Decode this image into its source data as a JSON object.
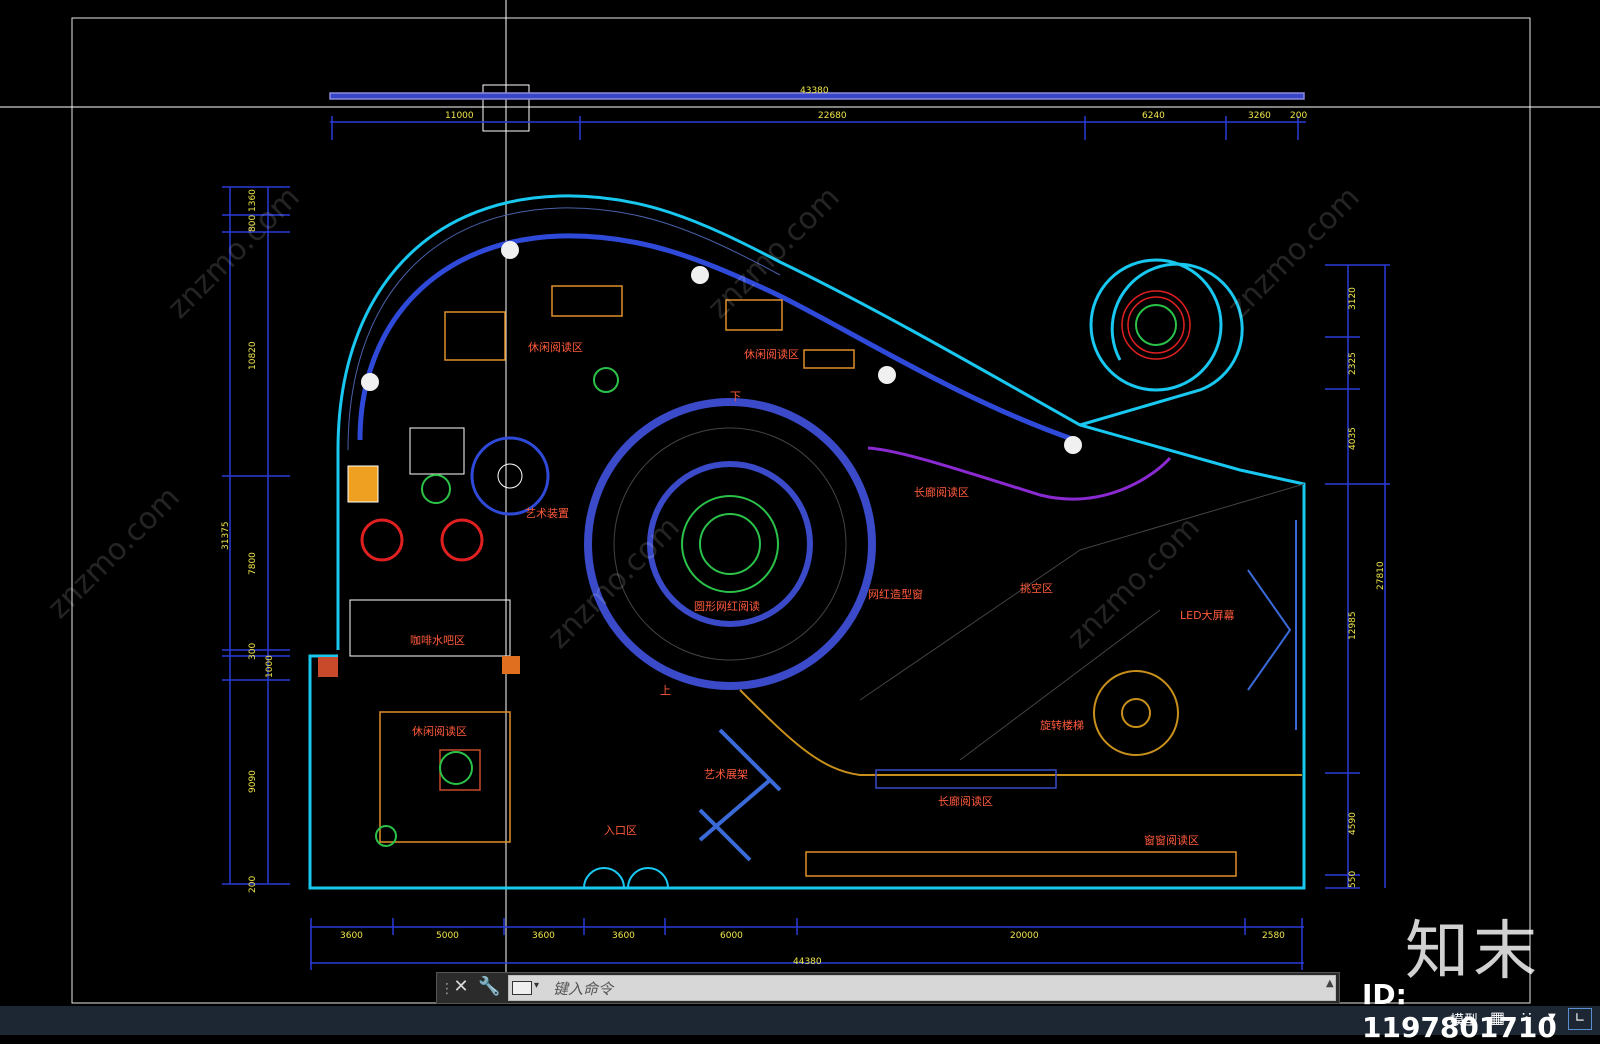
{
  "drawing": {
    "overall_top": "43380",
    "top_dims": [
      "11000",
      "22680",
      "6240",
      "3260",
      "200"
    ],
    "left_dims": [
      "800",
      "1360",
      "10820",
      "7800",
      "300",
      "1000",
      "9090",
      "200"
    ],
    "left_total": "31375",
    "right_dims": [
      "3120",
      "2325",
      "4035",
      "12985",
      "4590",
      "550"
    ],
    "right_total": "27810",
    "bottom_dims": [
      "3600",
      "5000",
      "3600",
      "3600",
      "6000",
      "20000",
      "2580"
    ],
    "bottom_total": "44380",
    "zones": {
      "leisure_reading_a": "休闲阅读区",
      "leisure_reading_b": "休闲阅读区",
      "leisure_reading_c": "休闲阅读区",
      "art_installation": "艺术装置",
      "circular_reading": "圆形网红阅读",
      "influencer_shape": "网红造型窗",
      "atrium": "挑空区",
      "led_screen": "LED大屏幕",
      "long_corridor_top": "长廊阅读区",
      "long_corridor_bottom": "长廊阅读区",
      "coffee_bar": "咖啡水吧区",
      "art_shelf": "艺术展架",
      "entrance": "入口区",
      "window_reading": "窗窗阅读区",
      "spiral_stair": "旋转楼梯",
      "up": "上",
      "down": "下"
    }
  },
  "commandline": {
    "placeholder": "键入命令"
  },
  "statusbar": {
    "model_label": "模型",
    "grid_icon": "grid-icon",
    "snap_icon": "snap-icon"
  },
  "watermark": {
    "site_text": "znzmo.com",
    "logo_text": "知末",
    "id_text": "ID: 1197801710"
  },
  "colors": {
    "background": "#000000",
    "dimension": "#1f2fd6",
    "dim_text": "#f0e64a",
    "wall_cyan": "#19c8f0",
    "furniture_orange": "#e0902a",
    "label_red": "#ff5a3c",
    "plant_green": "#2bc24a",
    "purple": "#8a2ad0"
  }
}
